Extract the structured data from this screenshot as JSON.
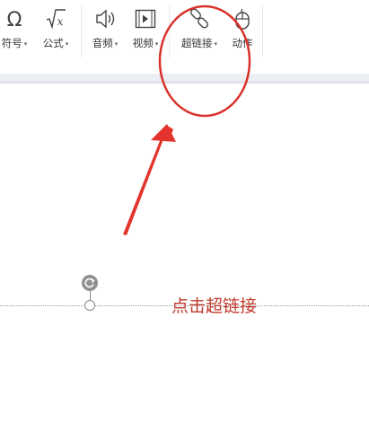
{
  "toolbar": {
    "items": [
      {
        "label": "符号",
        "icon": "omega-icon",
        "has_dropdown": true
      },
      {
        "label": "公式",
        "icon": "formula-icon",
        "has_dropdown": true
      },
      {
        "label": "音频",
        "icon": "speaker-icon",
        "has_dropdown": true
      },
      {
        "label": "视频",
        "icon": "video-icon",
        "has_dropdown": true
      },
      {
        "label": "超链接",
        "icon": "link-icon",
        "has_dropdown": true
      },
      {
        "label": "动作",
        "icon": "mouse-icon",
        "has_dropdown": false
      }
    ],
    "caret": "▾"
  },
  "annotation": {
    "caption": "点击超链接",
    "color": "#d9322b"
  }
}
